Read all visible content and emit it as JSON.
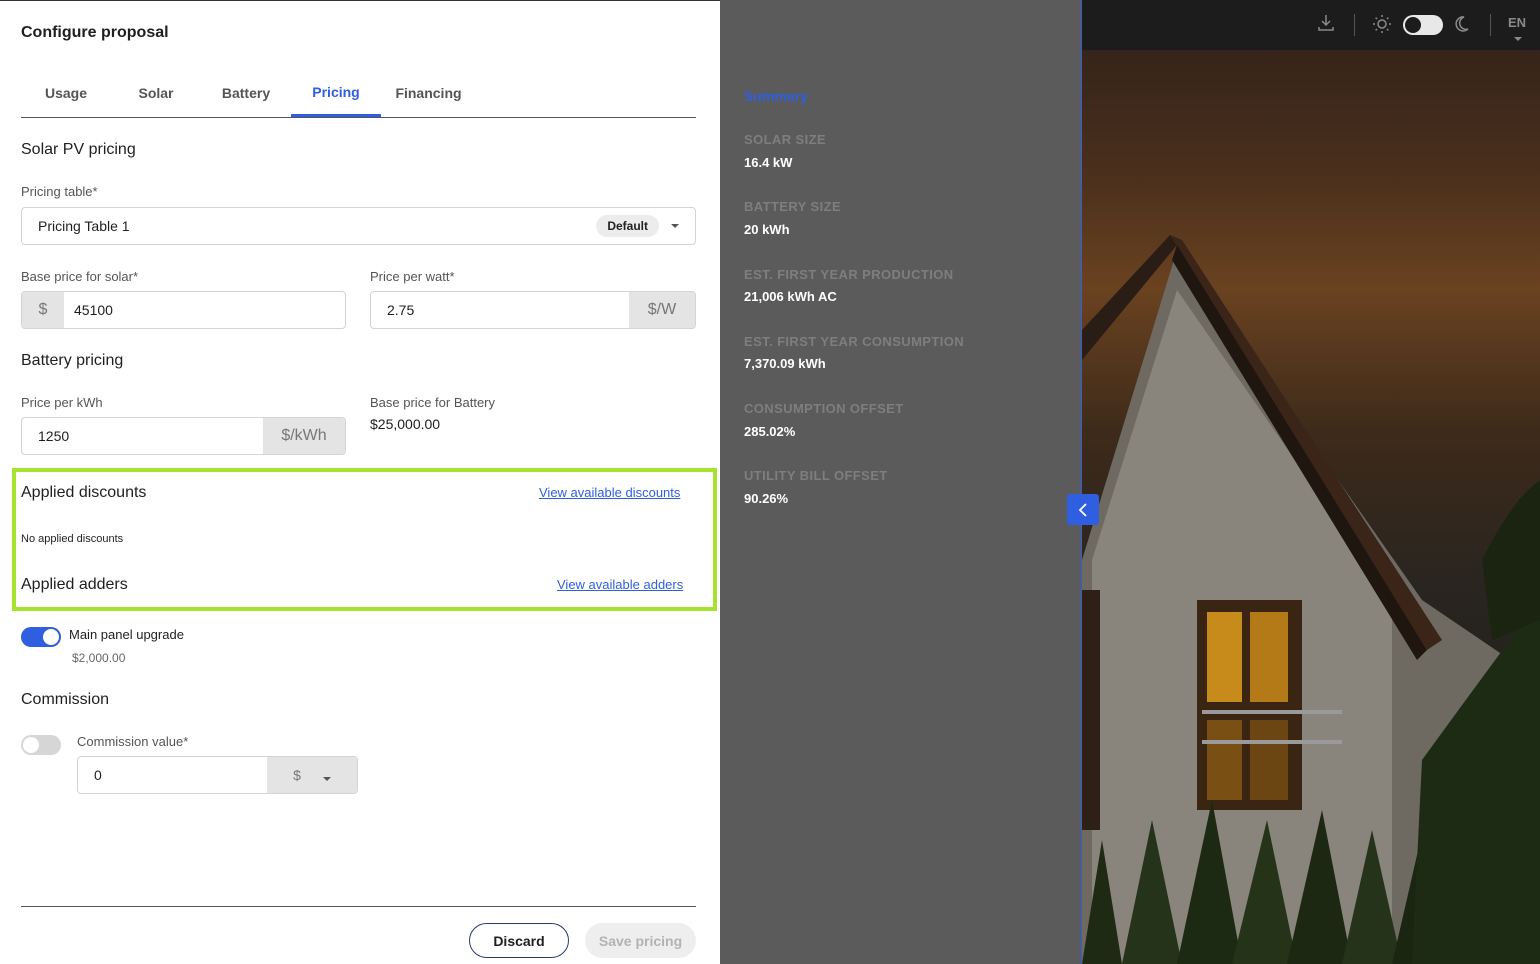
{
  "header": {
    "title": "Configure proposal"
  },
  "tabs": [
    {
      "label": "Usage"
    },
    {
      "label": "Solar"
    },
    {
      "label": "Battery"
    },
    {
      "label": "Pricing"
    },
    {
      "label": "Financing"
    }
  ],
  "solar_pricing": {
    "section_title": "Solar PV pricing",
    "pricing_table_label": "Pricing table*",
    "pricing_table_value": "Pricing Table 1",
    "pricing_table_badge": "Default",
    "base_price_label": "Base price for solar*",
    "base_price_prefix": "$",
    "base_price_value": "45100",
    "price_per_watt_label": "Price per watt*",
    "price_per_watt_value": "2.75",
    "price_per_watt_suffix": "$/W"
  },
  "battery_pricing": {
    "section_title": "Battery pricing",
    "price_per_kwh_label": "Price per kWh",
    "price_per_kwh_value": "1250",
    "price_per_kwh_suffix": "$/kWh",
    "base_price_label": "Base price for Battery",
    "base_price_value": "$25,000.00"
  },
  "discounts": {
    "title": "Applied discounts",
    "link": "View available discounts",
    "empty_text": "No applied discounts"
  },
  "adders": {
    "title": "Applied adders",
    "link": "View available adders",
    "items": [
      {
        "label": "Main panel upgrade",
        "price": "$2,000.00",
        "enabled": true
      }
    ]
  },
  "commission": {
    "section_title": "Commission",
    "value_label": "Commission value*",
    "value": "0",
    "unit": "$",
    "enabled": false
  },
  "actions": {
    "discard_label": "Discard",
    "save_label": "Save pricing"
  },
  "summary": {
    "title": "Summary",
    "items": [
      {
        "label": "SOLAR SIZE",
        "value": "16.4 kW"
      },
      {
        "label": "BATTERY SIZE",
        "value": "20 kWh"
      },
      {
        "label": "EST. FIRST YEAR PRODUCTION",
        "value": "21,006 kWh AC"
      },
      {
        "label": "EST. FIRST YEAR CONSUMPTION",
        "value": "7,370.09 kWh"
      },
      {
        "label": "CONSUMPTION OFFSET",
        "value": "285.02%"
      },
      {
        "label": "UTILITY BILL OFFSET",
        "value": "90.26%"
      }
    ]
  },
  "topbar": {
    "language": "EN"
  },
  "colors": {
    "accent": "#2f5fe0",
    "highlight": "#a6e22e",
    "summary_bg": "#5b5b5b"
  }
}
